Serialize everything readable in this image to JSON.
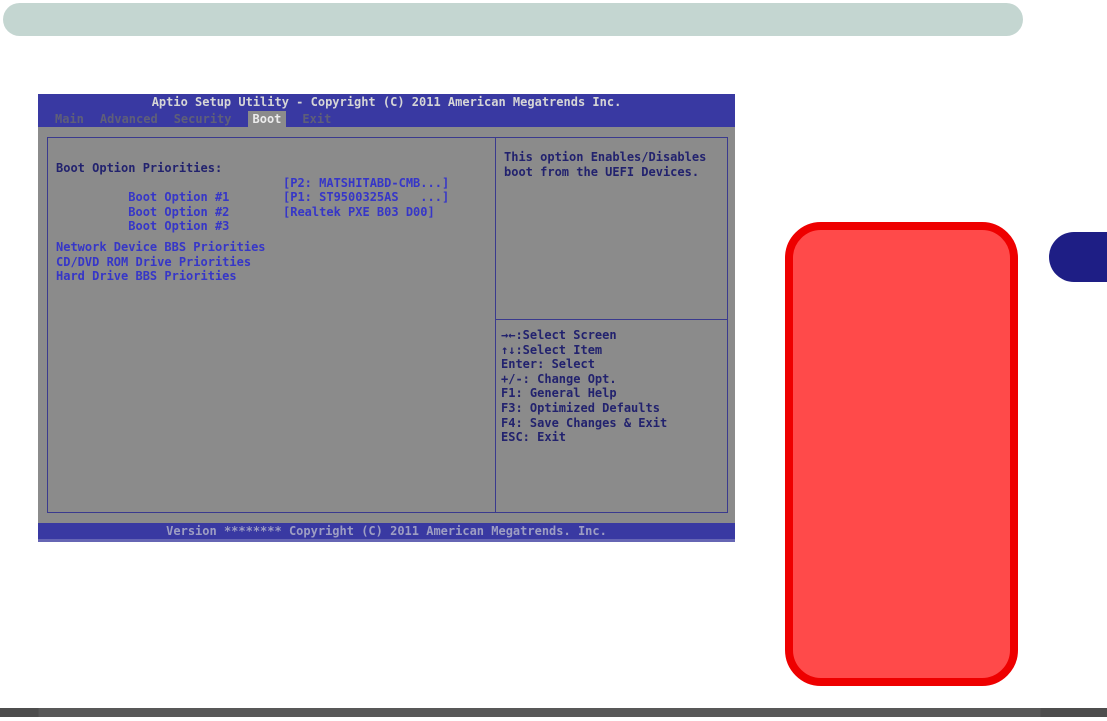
{
  "page": {
    "top_bar_color": "#c4d6d1",
    "bottom_bar_color": "#555555",
    "side_tab_color": "#1e1e85"
  },
  "annotation_box": {
    "border_color": "#ee0000",
    "fill_color": "#ff4a4a"
  },
  "bios": {
    "title": "Aptio Setup Utility - Copyright (C) 2011 American Megatrends Inc.",
    "tabs": [
      {
        "label": "Main",
        "selected": false
      },
      {
        "label": "Advanced",
        "selected": false
      },
      {
        "label": "Security",
        "selected": false
      },
      {
        "label": "Boot",
        "selected": true
      },
      {
        "label": "Exit",
        "selected": false
      }
    ],
    "left_pane": {
      "section_header": "Boot Option Priorities:",
      "options": [
        {
          "label": "Boot Option #1",
          "value": "[P2: MATSHITABD-CMB...]"
        },
        {
          "label": "Boot Option #2",
          "value": "[P1: ST9500325AS   ...]"
        },
        {
          "label": "Boot Option #3",
          "value": "[Realtek PXE B03 D00]"
        }
      ],
      "links": [
        "Network Device BBS Priorities",
        "CD/DVD ROM Drive Priorities",
        "Hard Drive BBS Priorities"
      ]
    },
    "right_pane": {
      "description_line1": "This option Enables/Disables",
      "description_line2": "boot from the UEFI Devices.",
      "help_lines": [
        "→←:Select Screen",
        "↑↓:Select Item",
        "Enter: Select",
        "+/-: Change Opt.",
        "F1: General Help",
        "F3: Optimized Defaults",
        "F4: Save Changes & Exit",
        "ESC: Exit"
      ]
    },
    "footer": "Version ******** Copyright (C) 2011 American Megatrends. Inc.",
    "colors": {
      "header_blue": "#3939a2",
      "body_gray": "#8b8b8b",
      "option_blue": "#3636c8",
      "navy_text": "#22226e",
      "border": "#3a3a8e"
    }
  }
}
